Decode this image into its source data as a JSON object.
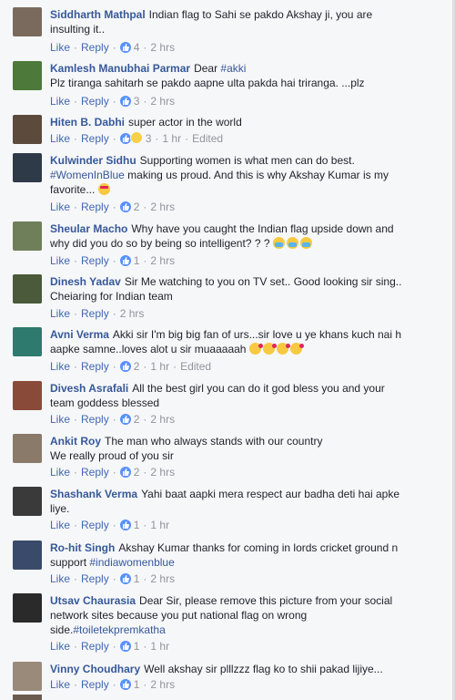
{
  "labels": {
    "like": "Like",
    "reply": "Reply",
    "separator": "·"
  },
  "comments": [
    {
      "author": "Siddharth Mathpal",
      "text": "Indian flag to Sahi se pakdo Akshay ji, you are insulting it..",
      "likes": "4",
      "time": "2 hrs",
      "edited": "",
      "avatar_color": "#7a6a5e"
    },
    {
      "author": "Kamlesh Manubhai Parmar",
      "text": "Dear",
      "hashtag": "#akki",
      "text2": "Plz tiranga sahitarh se pakdo aapne ulta pakda hai triranga. ...plz",
      "likes": "3",
      "time": "2 hrs",
      "edited": "",
      "avatar_color": "#4d7a3a"
    },
    {
      "author": "Hiten B. Dabhi",
      "text": "super actor in the world",
      "likes": "3",
      "time": "1 hr",
      "edited": "Edited",
      "avatar_color": "#5c4a3d"
    },
    {
      "author": "Kulwinder Sidhu",
      "text": "Supporting women is what men can do best.",
      "hashtag": "#WomenInBlue",
      "text2": "making us proud. And this is why Akshay Kumar is my favorite...",
      "likes": "2",
      "time": "2 hrs",
      "edited": "",
      "avatar_color": "#2f3a48"
    },
    {
      "author": "Sheular Macho",
      "text": "Why have you caught the Indian flag upside down and why did you do so by being so intelligent? ? ?",
      "likes": "1",
      "time": "2 hrs",
      "edited": "",
      "avatar_color": "#6e7f5a"
    },
    {
      "author": "Dinesh Yadav",
      "text": "Sir Me watching to you on TV set.. Good looking sir sing.. Cheiaring for Indian team",
      "likes": "",
      "time": "2 hrs",
      "edited": "",
      "avatar_color": "#4a5a3a"
    },
    {
      "author": "Avni Verma",
      "text": "Akki sir I'm big big fan of urs...sir love u ye khans kuch nai h aapke samne..loves alot u sir muaaaaah",
      "likes": "2",
      "time": "1 hr",
      "edited": "Edited",
      "avatar_color": "#2e7a6e"
    },
    {
      "author": "Divesh Asrafali",
      "text": "All the best girl you can do it god bless you and your team goddess blessed",
      "likes": "2",
      "time": "2 hrs",
      "edited": "",
      "avatar_color": "#8a4a3a"
    },
    {
      "author": "Ankit Roy",
      "text": "The man who always stands with our country",
      "text2": "We really proud of you sir",
      "likes": "2",
      "time": "2 hrs",
      "edited": "",
      "avatar_color": "#8a7a6a"
    },
    {
      "author": "Shashank Verma",
      "text": "Yahi baat aapki mera respect aur badha deti hai apke liye.",
      "likes": "1",
      "time": "1 hr",
      "edited": "",
      "avatar_color": "#3a3a3a"
    },
    {
      "author": "Ro-hit Singh",
      "text": "Akshay Kumar thanks for coming in lords cricket ground n support",
      "hashtag": "#indiawomenblue",
      "likes": "1",
      "time": "2 hrs",
      "edited": "",
      "avatar_color": "#3a4a6a"
    },
    {
      "author": "Utsav Chaurasia",
      "text": "Dear Sir, please remove this picture from your social network sites because you put national flag on wrong side.",
      "hashtag": "#toiletekpremkatha",
      "likes": "1",
      "time": "1 hr",
      "edited": "",
      "avatar_color": "#2a2a2a"
    },
    {
      "author": "Vinny Choudhary",
      "text": "Well akshay sir plllzzz flag ko to shii pakad lijiye...",
      "likes": "1",
      "time": "2 hrs",
      "edited": "",
      "avatar_color": "#9a8a7a"
    }
  ]
}
